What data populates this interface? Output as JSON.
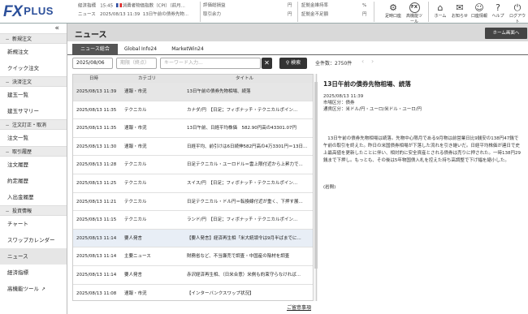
{
  "header": {
    "logo": "FX",
    "logo_sub": "PLUS",
    "ticker1_label": "経済指標",
    "ticker1_time": "15:45",
    "ticker1_text": "消費者物価指数（CPI）（前月...",
    "ticker2_label": "ニュース",
    "ticker2_time": "2025/08/13 11:39",
    "ticker2_text": "13日午前の債券先物...",
    "acct1": "評価総損益",
    "acct2": "取引余力",
    "unit1": "円",
    "unit2": "円",
    "acct3": "証拠金維持率",
    "acct4": "証拠金不足額",
    "unit3": "%",
    "unit4": "円",
    "icons": [
      {
        "name": "chart-settings-icon",
        "label": "足時口座"
      },
      {
        "name": "fx-tools-icon",
        "label": "高機能ツール"
      },
      {
        "name": "home-icon",
        "label": "ホーム"
      },
      {
        "name": "bell-icon",
        "label": "お知らせ"
      },
      {
        "name": "account-icon",
        "label": "口座情報"
      },
      {
        "name": "help-icon",
        "label": "ヘルプ"
      },
      {
        "name": "logout-icon",
        "label": "ログアウト"
      }
    ]
  },
  "sidebar": {
    "sections": [
      {
        "title": "新規注文",
        "items": [
          "新規注文",
          "クイック注文"
        ]
      },
      {
        "title": "決済注文",
        "items": [
          "建玉一覧",
          "建玉サマリー"
        ]
      },
      {
        "title": "注文訂正・取消",
        "items": [
          "注文一覧"
        ]
      },
      {
        "title": "取引履歴",
        "items": [
          "注文履歴",
          "約定履歴",
          "入出金履歴"
        ]
      },
      {
        "title": "投資情報",
        "items": [
          "チャート",
          "スワップカレンダー",
          "ニュース",
          "経済指標",
          "高機能ツール"
        ]
      }
    ]
  },
  "main": {
    "title": "ニュース",
    "home_button": "ホーム画面へ",
    "tabs": [
      "ニュース総合",
      "Global Info24",
      "MarketWin24"
    ],
    "date_value": "2025/08/06",
    "date_to_placeholder": "期限（終点）",
    "keyword_placeholder": "キーワード入力...",
    "search_button": "検索",
    "count": "全件数：2750件",
    "columns": [
      "日時",
      "カテゴリ",
      "タイトル"
    ],
    "rows": [
      {
        "time": "2025/08/13 11:39",
        "cat": "速報・市況",
        "title": "13日午前の債券先物相場、続落"
      },
      {
        "time": "2025/08/13 11:35",
        "cat": "テクニカル",
        "title": "カナダ/円　【日足；フィボナッチ・テクニカルポイン..."
      },
      {
        "time": "2025/08/13 11:35",
        "cat": "速報・市況",
        "title": "13日午前、日経平均株価　582.90円高の43301.07円"
      },
      {
        "time": "2025/08/13 11:30",
        "cat": "速報・市況",
        "title": "日経平均、前引けは6日続伸582円高の4万3301円＝13日..."
      },
      {
        "time": "2025/08/13 11:28",
        "cat": "テクニカル",
        "title": "日足テクニカル・ユーロドル＝雲上限付近から上昇力で..."
      },
      {
        "time": "2025/08/13 11:25",
        "cat": "テクニカル",
        "title": "スイス/円　【日足；フィボナッチ・テクニカルポイン..."
      },
      {
        "time": "2025/08/13 11:21",
        "cat": "テクニカル",
        "title": "日足テクニカル・ドル円＝転換線付近が重く、下押す展..."
      },
      {
        "time": "2025/08/13 11:15",
        "cat": "テクニカル",
        "title": "ランド/円　【日足；フィボナッチ・テクニカルポイン..."
      },
      {
        "time": "2025/08/13 11:14",
        "cat": "要人発言",
        "title": "【要人発言】経済再生相「米大統領令は9月半ばまでに..."
      },
      {
        "time": "2025/08/13 11:14",
        "cat": "主要ニュース",
        "title": "財務省など、不当廉売で調査・中国産の陰材を調査"
      },
      {
        "time": "2025/08/13 11:14",
        "cat": "要人発言",
        "title": "赤沢経済再生相、（日米合意）米側も約束守らなければ..."
      },
      {
        "time": "2025/08/13 11:08",
        "cat": "速報・市況",
        "title": "【インターバンクスワップ状況】"
      }
    ],
    "detail": {
      "title": "13日午前の債券先物相場、続落",
      "datetime": "2025/08/13 11:39",
      "market": "市場区分：債券",
      "currency": "通貨区分：米ドル/円・ユーロ/米ドル・ユーロ/円",
      "body": "13日午前の債券先物相場は続落。先物中心限月である9月物は前営業日比9銭安の138円47銭で午前の取引を終えた。昨日の米国債券相場が下落した流れを引き継いだ。日経平均株価が連日で史上最高値を更新したことに伴い、相対的に安全資産とされる債券は売りに押された。一時138円29銭まで下押し。もっとも、その後は5年物国債入札を控えた持ち高調整で下げ幅を縮小した。",
      "source": "(岩間)"
    },
    "notice": "ご留意事項"
  }
}
